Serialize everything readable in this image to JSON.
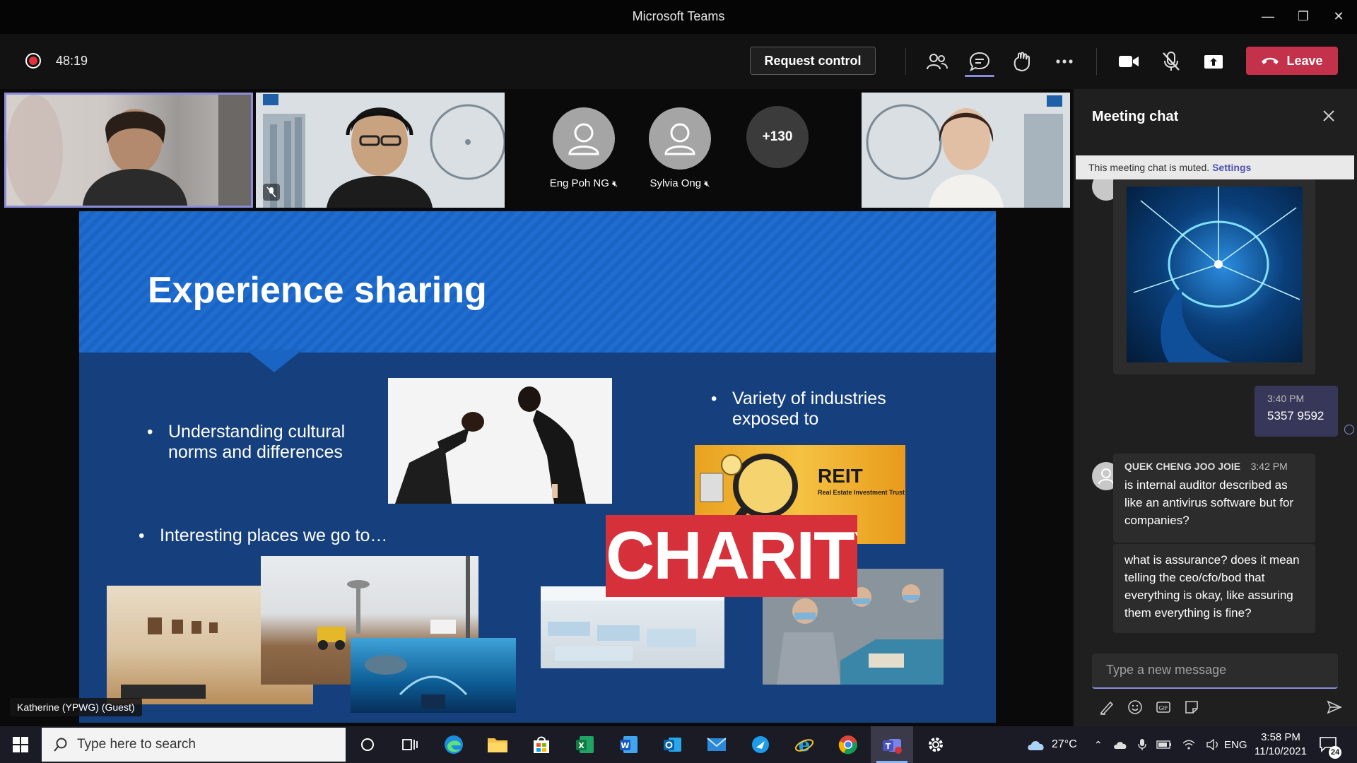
{
  "window": {
    "title": "Microsoft Teams"
  },
  "toolbar": {
    "timer": "48:19",
    "request_control_label": "Request control",
    "leave_label": "Leave"
  },
  "participants": {
    "names": [
      "Eng Poh NG",
      "Sylvia Ong"
    ],
    "more_count": "+130",
    "presenter_name": "Katherine (YPWG) (Guest)"
  },
  "slide": {
    "title": "Experience sharing",
    "bullets": [
      "Understanding cultural norms and differences",
      "Variety of industries exposed to",
      "Interesting places we go to…"
    ],
    "reit_title": "REIT",
    "reit_sub": "Real Estate Investment Trust",
    "charity_text": "CHARITY"
  },
  "chat": {
    "title": "Meeting chat",
    "muted_notice": "This meeting chat is muted.",
    "settings_link": "Settings",
    "own_message": {
      "time": "3:40 PM",
      "text": "5357 9592"
    },
    "message": {
      "author": "QUEK CHENG JOO JOIE",
      "time": "3:42 PM",
      "texts": [
        "is internal auditor described as like an antivirus software but for companies?",
        "what is assurance? does it mean telling the ceo/cfo/bod that everything is okay, like assuring them everything is fine?"
      ]
    },
    "compose_placeholder": "Type a new message"
  },
  "taskbar": {
    "search_placeholder": "Type here to search",
    "weather": "27°C",
    "language": "ENG",
    "time": "3:58 PM",
    "date": "11/10/2021",
    "notifications": "24"
  },
  "colors": {
    "accent": "#8b8cdb",
    "leave": "#c4314b",
    "slide_bg": "#15407d",
    "slide_header": "#1a64c4"
  }
}
